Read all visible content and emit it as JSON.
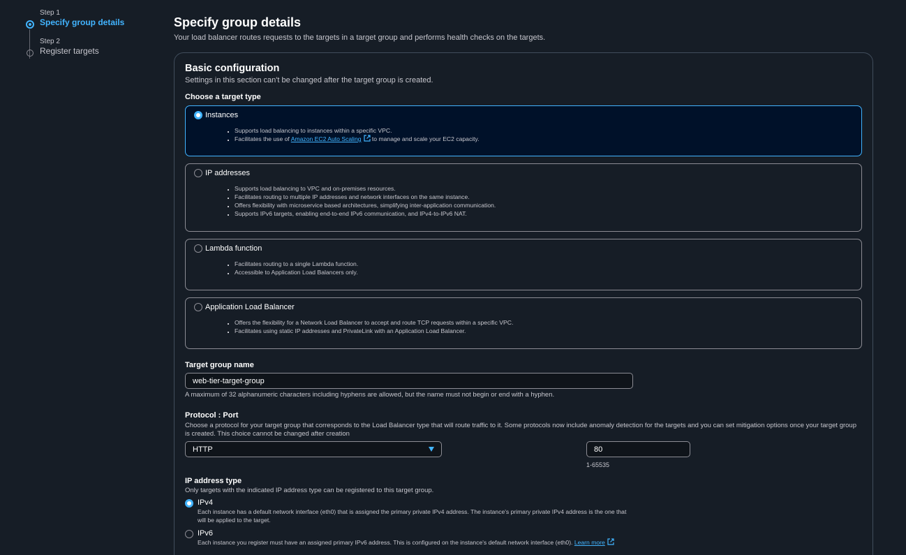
{
  "stepper": {
    "steps": [
      {
        "number": "Step 1",
        "label": "Specify group details"
      },
      {
        "number": "Step 2",
        "label": "Register targets"
      }
    ]
  },
  "header": {
    "title": "Specify group details",
    "description": "Your load balancer routes requests to the targets in a target group and performs health checks on the targets."
  },
  "basic": {
    "title": "Basic configuration",
    "description": "Settings in this section can't be changed after the target group is created.",
    "target_type_label": "Choose a target type",
    "target_types": [
      {
        "title": "Instances",
        "selected": true,
        "bullets": [
          "Supports load balancing to instances within a specific VPC."
        ],
        "bullet_link": {
          "prefix": "Facilitates the use of ",
          "link": "Amazon EC2 Auto Scaling",
          "suffix": " to manage and scale your EC2 capacity."
        }
      },
      {
        "title": "IP addresses",
        "selected": false,
        "bullets": [
          "Supports load balancing to VPC and on-premises resources.",
          "Facilitates routing to multiple IP addresses and network interfaces on the same instance.",
          "Offers flexibility with microservice based architectures, simplifying inter-application communication.",
          "Supports IPv6 targets, enabling end-to-end IPv6 communication, and IPv4-to-IPv6 NAT."
        ]
      },
      {
        "title": "Lambda function",
        "selected": false,
        "bullets": [
          "Facilitates routing to a single Lambda function.",
          "Accessible to Application Load Balancers only."
        ]
      },
      {
        "title": "Application Load Balancer",
        "selected": false,
        "bullets": [
          "Offers the flexibility for a Network Load Balancer to accept and route TCP requests within a specific VPC.",
          "Facilitates using static IP addresses and PrivateLink with an Application Load Balancer."
        ]
      }
    ],
    "name_label": "Target group name",
    "name_value": "web-tier-target-group",
    "name_hint": "A maximum of 32 alphanumeric characters including hyphens are allowed, but the name must not begin or end with a hyphen.",
    "protocol_label": "Protocol : Port",
    "protocol_desc": "Choose a protocol for your target group that corresponds to the Load Balancer type that will route traffic to it. Some protocols now include anomaly detection for the targets and you can set mitigation options once your target group is created. This choice cannot be changed after creation",
    "protocol_value": "HTTP",
    "port_value": "80",
    "port_hint": "1-65535",
    "ip_type_label": "IP address type",
    "ip_type_desc": "Only targets with the indicated IP address type can be registered to this target group.",
    "ipv4": {
      "title": "IPv4",
      "desc": "Each instance has a default network interface (eth0) that is assigned the primary private IPv4 address. The instance's primary private IPv4 address is the one that will be applied to the target."
    },
    "ipv6": {
      "title": "IPv6",
      "desc": "Each instance you register must have an assigned primary IPv6 address. This is configured on the instance's default network interface (eth0). ",
      "link": "Learn more"
    }
  },
  "colors": {
    "accent": "#42b4ff",
    "background": "#161d26",
    "selected_tile": "#001129"
  }
}
